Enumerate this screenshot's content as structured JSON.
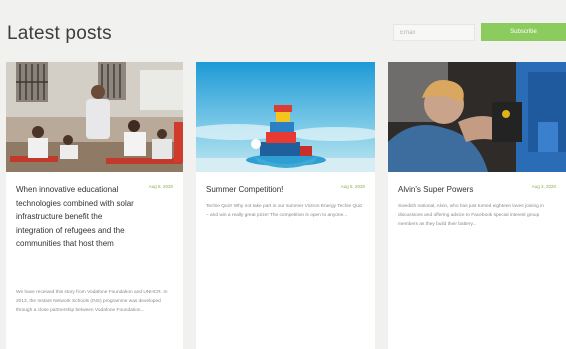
{
  "header": {
    "title": "Latest posts",
    "email_placeholder": "Email",
    "subscribe_label": "Subscribe"
  },
  "posts": [
    {
      "title": "When innovative educational technologies combined with solar infrastructure benefit the integration of refugees and the communities that host them",
      "date": "Aug 8, 2020",
      "excerpt": "We have received this story from Vodafone Foundation and UNHCR. In 2013, the Instant Network Schools (INS) programme was developed through a close partnership between Vodafone Foundation..."
    },
    {
      "title": "Summer Competition!",
      "date": "Aug 5, 2020",
      "excerpt": "Techie Quiz! Why not take part in our summer Victron Energy Techie Quiz – and win a really great prize! The competition is open to anyone..."
    },
    {
      "title": "Alvin's Super Powers",
      "date": "Aug 3, 2020",
      "excerpt": "Swedish national, Alvin, who has just turned eighteen loves joining in discussions and offering advice to Facebook special interest group members as they build their battery..."
    }
  ],
  "colors": {
    "accent": "#8ccb5d",
    "background": "#f1f1ef",
    "card": "#ffffff",
    "date": "#7fb04d"
  }
}
